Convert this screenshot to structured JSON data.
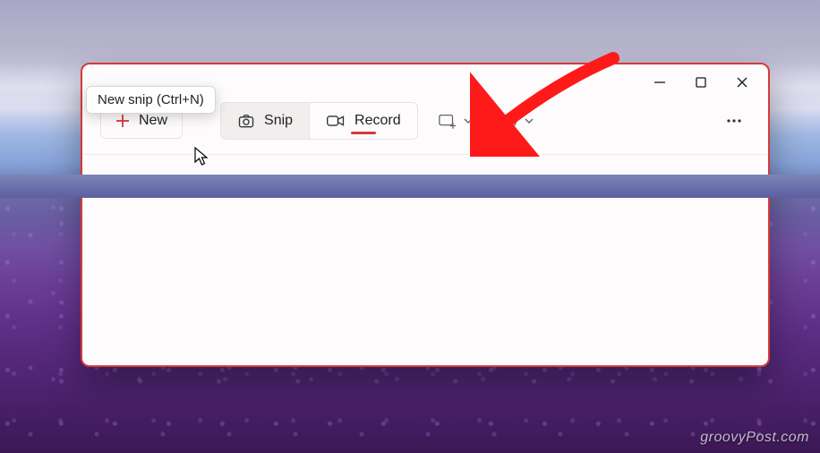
{
  "window": {
    "tooltip": "New snip (Ctrl+N)",
    "toolbar": {
      "new_label": "New",
      "snip_label": "Snip",
      "record_label": "Record"
    }
  },
  "watermark": "groovyPost.com",
  "colors": {
    "accent_red": "#d53a3a",
    "window_border": "#d53a3a",
    "window_bg": "#fdfbfb"
  }
}
